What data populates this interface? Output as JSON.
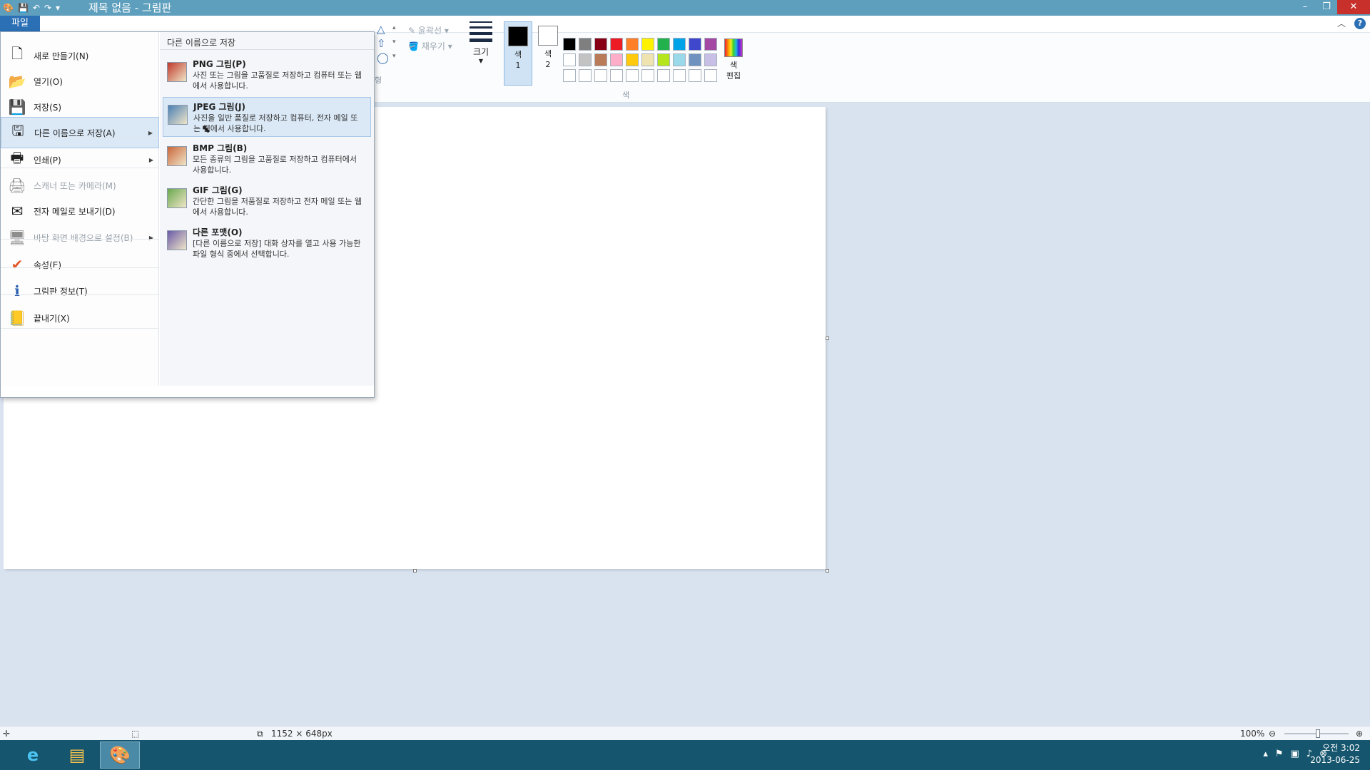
{
  "window": {
    "title": "제목 없음 - 그림판",
    "controls": {
      "minimize": "–",
      "restore": "❐",
      "close": "✕"
    }
  },
  "qat": {
    "save_icon": "save-icon",
    "undo_icon": "undo-icon",
    "redo_icon": "redo-icon",
    "customize_icon": "dropdown-icon"
  },
  "ribbon": {
    "file_tab": "파일",
    "outline_label": "윤곽선",
    "fill_label": "채우기",
    "size_label": "크기",
    "color1_label": "색\n1",
    "color2_label": "색\n2",
    "edit_colors_label": "색\n편집",
    "colors_group_label": "색",
    "shapes_group_fragment": "형",
    "palette": [
      "#000000",
      "#7f7f7f",
      "#880015",
      "#ed1c24",
      "#ff7f27",
      "#fff200",
      "#22b14c",
      "#00a2e8",
      "#3f48cc",
      "#a349a4",
      "#ffffff",
      "#c3c3c3",
      "#b97a57",
      "#ffaec9",
      "#ffc90e",
      "#efe4b0",
      "#b5e61d",
      "#99d9ea",
      "#7092be",
      "#c8bfe7",
      "#ffffff",
      "#ffffff",
      "#ffffff",
      "#ffffff",
      "#ffffff",
      "#ffffff",
      "#ffffff",
      "#ffffff",
      "#ffffff",
      "#ffffff"
    ],
    "color1": "#000000",
    "color2": "#ffffff"
  },
  "file_menu": {
    "items": [
      {
        "label": "새로 만들기(N)",
        "icon": "new-file-icon"
      },
      {
        "label": "열기(O)",
        "icon": "open-folder-icon"
      },
      {
        "label": "저장(S)",
        "icon": "save-icon"
      },
      {
        "label": "다른 이름으로 저장(A)",
        "icon": "save-as-icon"
      },
      {
        "label": "인쇄(P)",
        "icon": "printer-icon"
      },
      {
        "label": "스캐너 또는 카메라(M)",
        "icon": "scanner-icon"
      },
      {
        "label": "전자 메일로 보내기(D)",
        "icon": "email-icon"
      },
      {
        "label": "바탕 화면 배경으로 설정(B)",
        "icon": "desktop-background-icon"
      },
      {
        "label": "속성(E)",
        "icon": "checkmark-icon"
      },
      {
        "label": "그림판 정보(T)",
        "icon": "info-icon"
      },
      {
        "label": "끝내기(X)",
        "icon": "exit-icon"
      }
    ],
    "submenu_title": "다른 이름으로 저장",
    "submenu": [
      {
        "title": "PNG 그림(P)",
        "desc": "사진 또는 그림을 고품질로 저장하고 컴퓨터 또는 웹에서 사용합니다.",
        "icon": "png-image-icon"
      },
      {
        "title": "JPEG 그림(J)",
        "desc": "사진을 일반 품질로 저장하고 컴퓨터, 전자 메일 또는 웹에서 사용합니다.",
        "icon": "jpeg-image-icon"
      },
      {
        "title": "BMP 그림(B)",
        "desc": "모든 종류의 그림을 고품질로 저장하고 컴퓨터에서 사용합니다.",
        "icon": "bmp-image-icon"
      },
      {
        "title": "GIF 그림(G)",
        "desc": "간단한 그림을 저품질로 저장하고 전자 메일 또는 웹에서 사용합니다.",
        "icon": "gif-image-icon"
      },
      {
        "title": "다른 포맷(O)",
        "desc": "[다른 이름으로 저장] 대화 상자를 열고 사용 가능한 파일 형식 중에서 선택합니다.",
        "icon": "other-format-icon"
      }
    ]
  },
  "statusbar": {
    "canvas_size": "1152 × 648px",
    "zoom": "100%"
  },
  "taskbar": {
    "clock_time": "오전 3:02",
    "clock_date": "2013-06-25"
  }
}
